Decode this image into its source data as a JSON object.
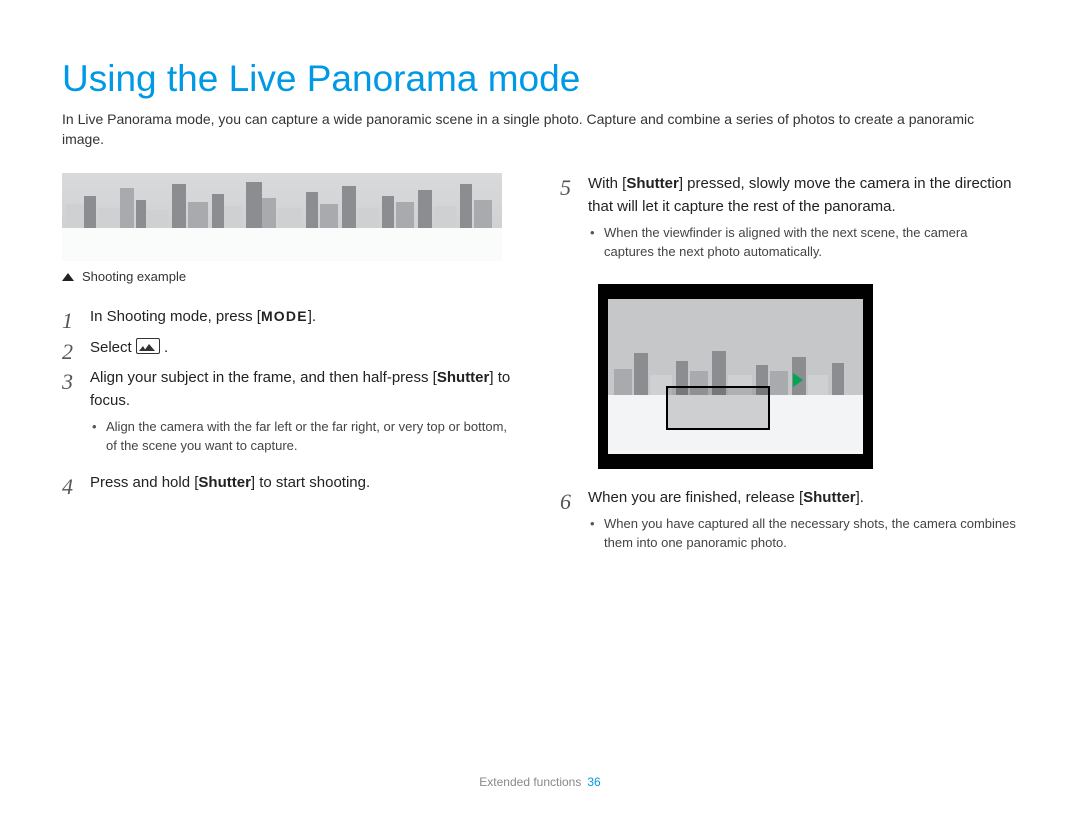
{
  "title": "Using the Live Panorama mode",
  "intro": "In Live Panorama mode, you can capture a wide panoramic scene in a single photo. Capture and combine a series of photos to create a panoramic image.",
  "shooting_caption": "Shooting example",
  "steps": {
    "s1_pre": "In Shooting mode, press [",
    "s1_key": "MODE",
    "s1_post": "].",
    "s2_pre": "Select ",
    "s2_post": " .",
    "s3_pre": "Align your subject in the frame, and then half-press [",
    "s3_bold": "Shutter",
    "s3_post": "] to focus.",
    "s3_note": "Align the camera with the far left or the far right, or very top or bottom, of the scene you want to capture.",
    "s4_pre": "Press and hold [",
    "s4_bold": "Shutter",
    "s4_post": "] to start shooting.",
    "s5_pre": "With [",
    "s5_bold": "Shutter",
    "s5_post": "] pressed, slowly move the camera in the direction that will let it capture the rest of the panorama.",
    "s5_note": "When the viewfinder is aligned with the next scene, the camera captures the next photo automatically.",
    "s6_pre": "When you are finished, release [",
    "s6_bold": "Shutter",
    "s6_post": "].",
    "s6_note": "When you have captured all the necessary shots, the camera combines them into one panoramic photo."
  },
  "footer": {
    "section": "Extended functions",
    "page": "36"
  }
}
